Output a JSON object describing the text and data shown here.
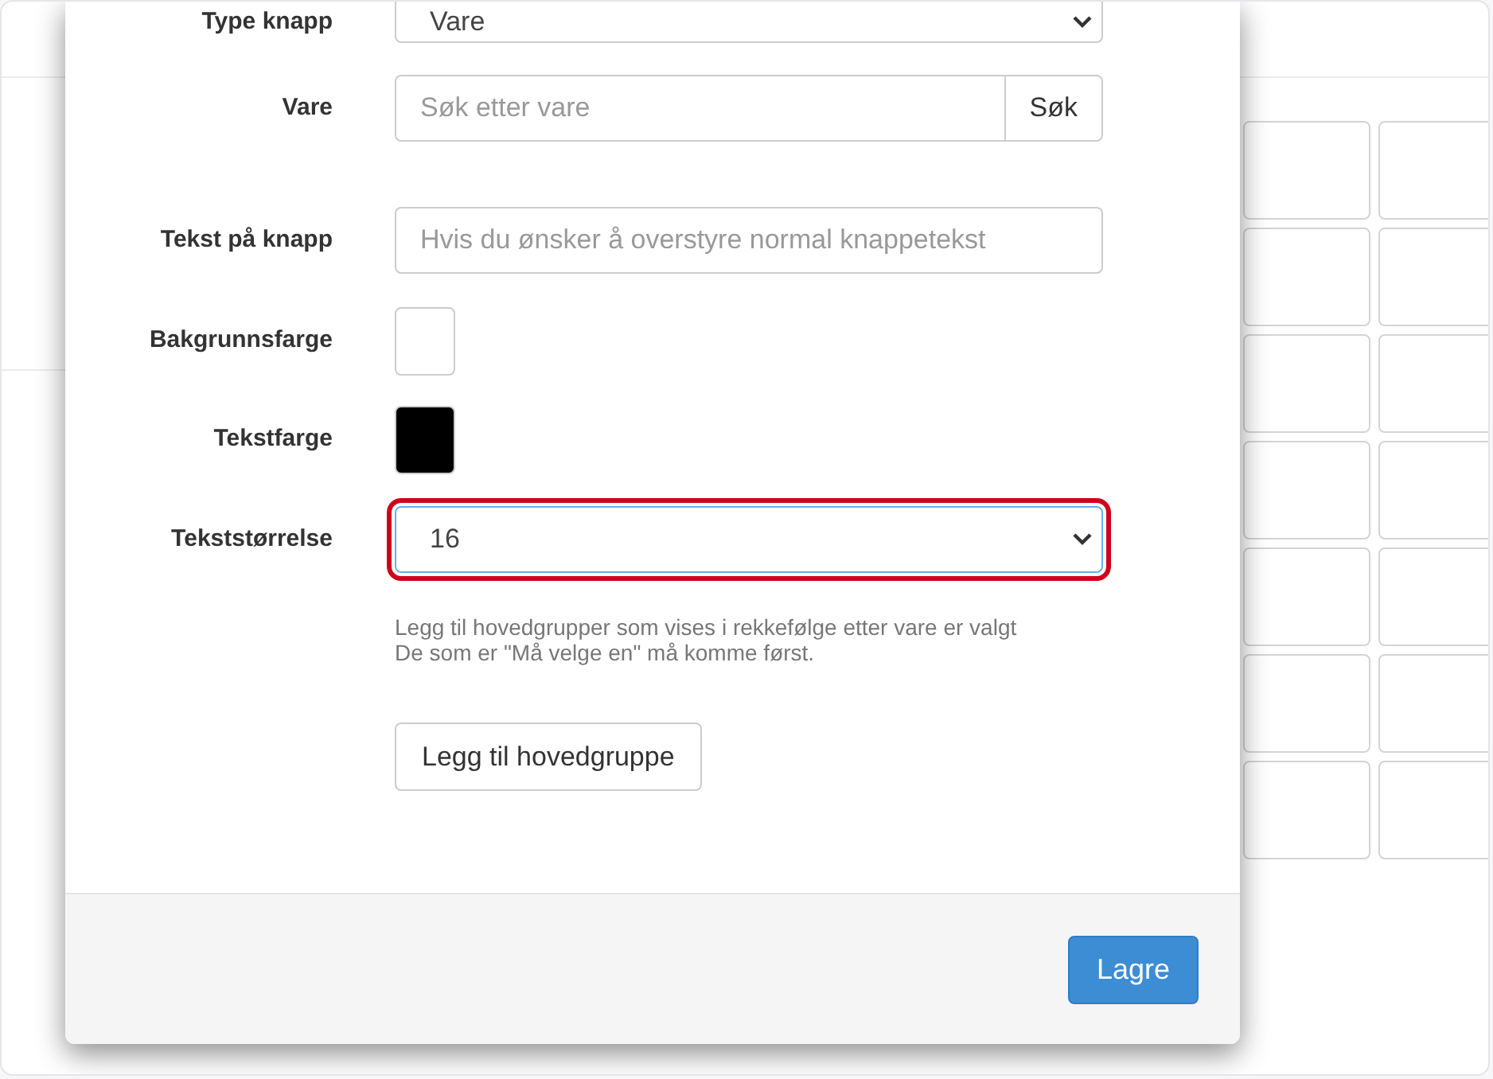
{
  "form": {
    "rows": [
      {
        "kind": "select",
        "label": "Type knapp",
        "value": "Vare",
        "highlighted": false
      },
      {
        "kind": "search",
        "label": "Vare",
        "placeholder": "Søk etter vare",
        "button": "Søk"
      },
      {
        "kind": "text",
        "label": "Tekst på knapp",
        "placeholder": "Hvis du ønsker å overstyre normal knappetekst"
      },
      {
        "kind": "color",
        "label": "Bakgrunnsfarge",
        "color": "#ffffff"
      },
      {
        "kind": "color",
        "label": "Tekstfarge",
        "color": "#000000"
      },
      {
        "kind": "select",
        "label": "Tekststørrelse",
        "value": "16",
        "highlighted": true
      }
    ],
    "help_lines": [
      "Legg til hovedgrupper som vises i rekkefølge etter vare er valgt",
      "De som er \"Må velge en\" må komme først."
    ],
    "add_button": "Legg til hovedgruppe"
  },
  "footer": {
    "save_button": "Lagre"
  }
}
